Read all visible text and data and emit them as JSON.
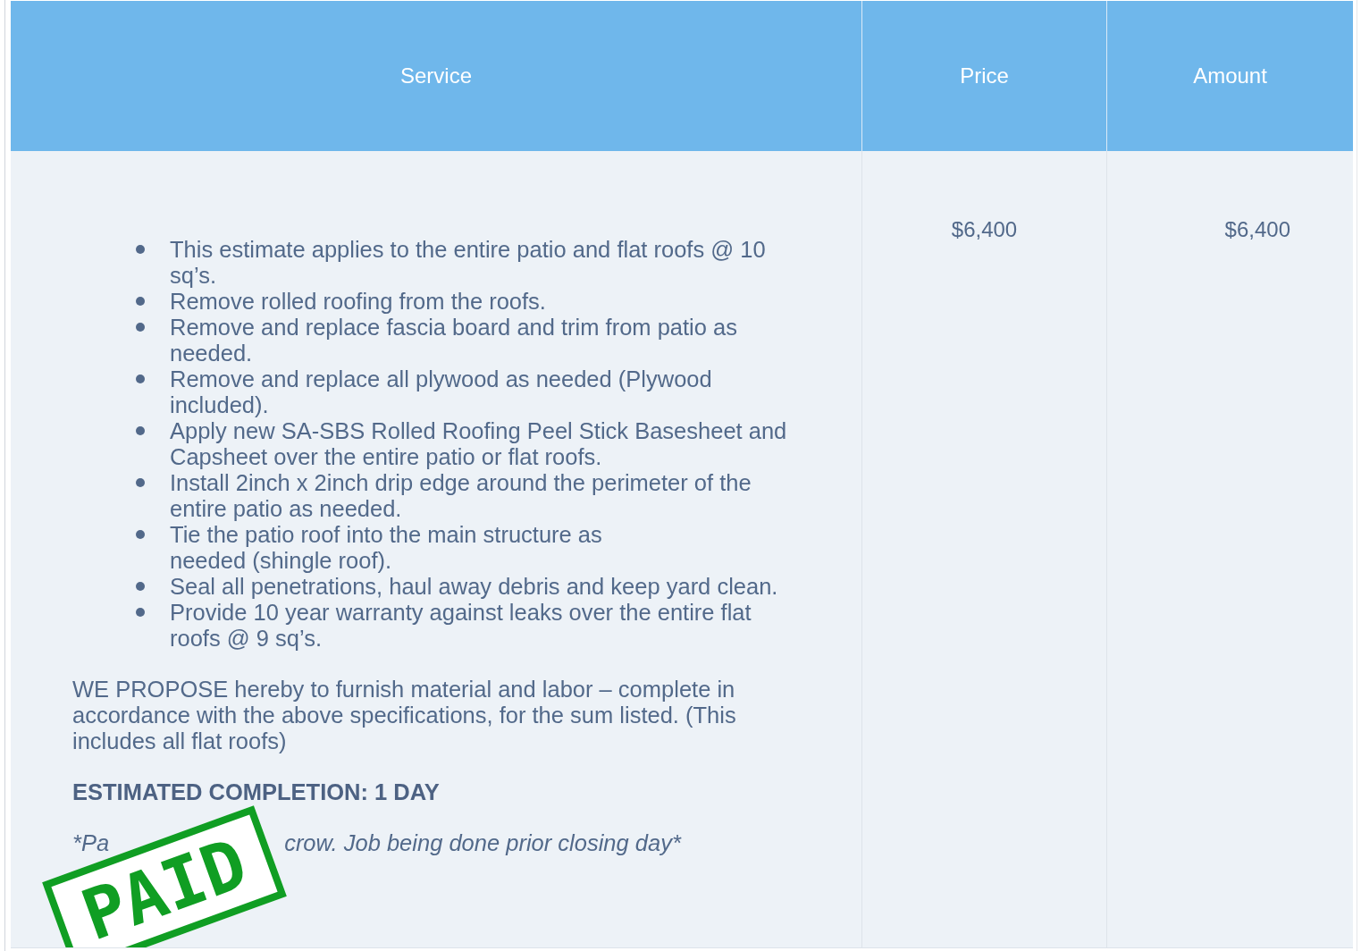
{
  "table": {
    "columns": [
      "Service",
      "Price",
      "Amount"
    ],
    "rows": [
      {
        "service": {
          "items": [
            "This estimate applies to the entire patio and flat roofs @ 10 sq’s.",
            "Remove rolled roofing from the roofs.",
            "Remove and replace fascia board and trim from patio as needed.",
            "Remove and replace all plywood as needed (Plywood included).",
            "Apply new SA-SBS Rolled Roofing Peel Stick Basesheet and Capsheet over the entire patio or flat roofs.",
            "Install 2inch x 2inch drip edge around the perimeter of the entire patio as needed.",
            "Tie the patio roof into the main structure as\nneeded (shingle roof).",
            "Seal all penetrations, haul away debris and keep yard clean.",
            "Provide 10 year warranty against leaks over the entire flat roofs @ 9 sq’s."
          ],
          "proposal": "WE PROPOSE hereby to furnish material and labor – complete in accordance with the above specifications, for the sum listed. (This includes all flat roofs)",
          "completion": "ESTIMATED COMPLETION: 1 DAY",
          "note_start": "*Pa",
          "note_end": "crow. Job being done prior closing day*"
        },
        "price": "$6,400",
        "amount": "$6,400"
      }
    ]
  },
  "stamp": {
    "text": "PAID"
  }
}
